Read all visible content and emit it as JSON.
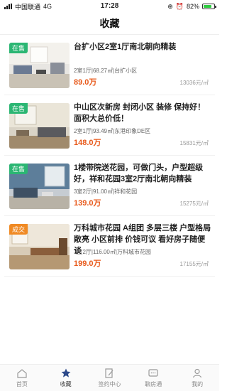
{
  "status_bar": {
    "carrier": "中国联通",
    "network": "4G",
    "time": "17:28",
    "battery": "82%",
    "battery_level": 0.82
  },
  "header": {
    "title": "收藏"
  },
  "listings": [
    {
      "badge": "在售",
      "badge_color": "#2bb673",
      "title": "台扩小区2室1厅南北朝向精装",
      "meta": "2室1厅|68.27㎡|台扩小区",
      "price": "89.0万",
      "unit_price": "13036元/㎡"
    },
    {
      "badge": "在售",
      "badge_color": "#2bb673",
      "title": "中山区次新房 封闭小区 装修 保持好！面积大总价低！",
      "meta": "2室1厅|93.49㎡|东港印象DE区",
      "price": "148.0万",
      "unit_price": "15831元/㎡"
    },
    {
      "badge": "在售",
      "badge_color": "#2bb673",
      "title": "1楼带院送花园，可做门头，户型超级好，祥和花园3室2厅南北朝向精装",
      "meta": "3室2厅|91.00㎡|祥和花园",
      "price": "139.0万",
      "unit_price": "15275元/㎡"
    },
    {
      "badge": "成交",
      "badge_color": "#f08a24",
      "title": "万科城市花园 A组团 多层三楼 户型格局敞亮 小区前排 价钱可议 看好房子随便谈",
      "meta": "3室2厅|116.00㎡|万科城市花园",
      "price": "199.0万",
      "unit_price": "17155元/㎡"
    }
  ],
  "tabs": [
    {
      "label": "首页",
      "icon": "home-icon"
    },
    {
      "label": "收藏",
      "icon": "star-icon",
      "active": true
    },
    {
      "label": "签约中心",
      "icon": "contract-icon"
    },
    {
      "label": "聊房通",
      "icon": "chat-icon"
    },
    {
      "label": "我的",
      "icon": "user-icon"
    }
  ],
  "colors": {
    "accent_price": "#e8591a",
    "active_tab": "#2d4a8a"
  }
}
